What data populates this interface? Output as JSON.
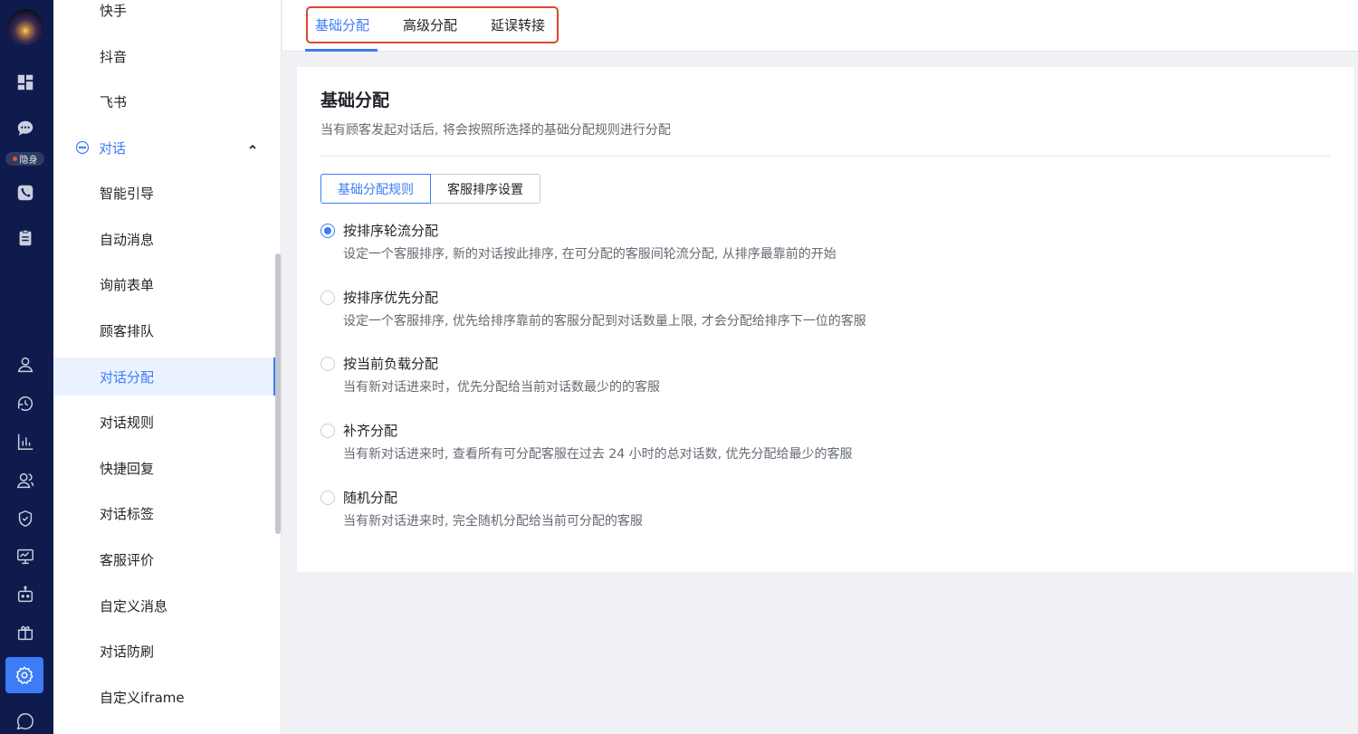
{
  "rail": {
    "status_text": "隐身",
    "icons": [
      "dashboard-icon",
      "chat-icon",
      "phone-icon",
      "clipboard-icon",
      "user-icon",
      "history-icon",
      "bar-chart-icon",
      "team-icon",
      "shield-icon",
      "monitor-icon",
      "robot-icon",
      "gift-icon",
      "gear-icon",
      "message-icon"
    ],
    "active_icon": "gear-icon",
    "accent": "#3d7bf7",
    "background": "#0f1b4d"
  },
  "sidebar": {
    "top_items": [
      {
        "label": "快手"
      },
      {
        "label": "抖音"
      },
      {
        "label": "飞书"
      }
    ],
    "group": {
      "label": "对话",
      "expanded": true
    },
    "items": [
      {
        "label": "智能引导"
      },
      {
        "label": "自动消息"
      },
      {
        "label": "询前表单"
      },
      {
        "label": "顾客排队"
      },
      {
        "label": "对话分配",
        "selected": true
      },
      {
        "label": "对话规则"
      },
      {
        "label": "快捷回复"
      },
      {
        "label": "对话标签"
      },
      {
        "label": "客服评价"
      },
      {
        "label": "自定义消息"
      },
      {
        "label": "对话防刷"
      },
      {
        "label": "自定义iframe"
      }
    ]
  },
  "tabs": [
    {
      "label": "基础分配",
      "active": true
    },
    {
      "label": "高级分配"
    },
    {
      "label": "延误转接"
    }
  ],
  "main": {
    "title": "基础分配",
    "description": "当有顾客发起对话后, 将会按照所选择的基础分配规则进行分配",
    "segments": [
      {
        "label": "基础分配规则",
        "active": true
      },
      {
        "label": "客服排序设置"
      }
    ],
    "options": [
      {
        "label": "按排序轮流分配",
        "desc": "设定一个客服排序, 新的对话按此排序, 在可分配的客服间轮流分配, 从排序最靠前的开始",
        "checked": true
      },
      {
        "label": "按排序优先分配",
        "desc": "设定一个客服排序, 优先给排序靠前的客服分配到对话数量上限, 才会分配给排序下一位的客服"
      },
      {
        "label": "按当前负载分配",
        "desc": "当有新对话进来时，优先分配给当前对话数最少的的客服"
      },
      {
        "label": "补齐分配",
        "desc": "当有新对话进来时, 查看所有可分配客服在过去 24 小时的总对话数, 优先分配给最少的客服"
      },
      {
        "label": "随机分配",
        "desc": "当有新对话进来时, 完全随机分配给当前可分配的客服"
      }
    ]
  }
}
